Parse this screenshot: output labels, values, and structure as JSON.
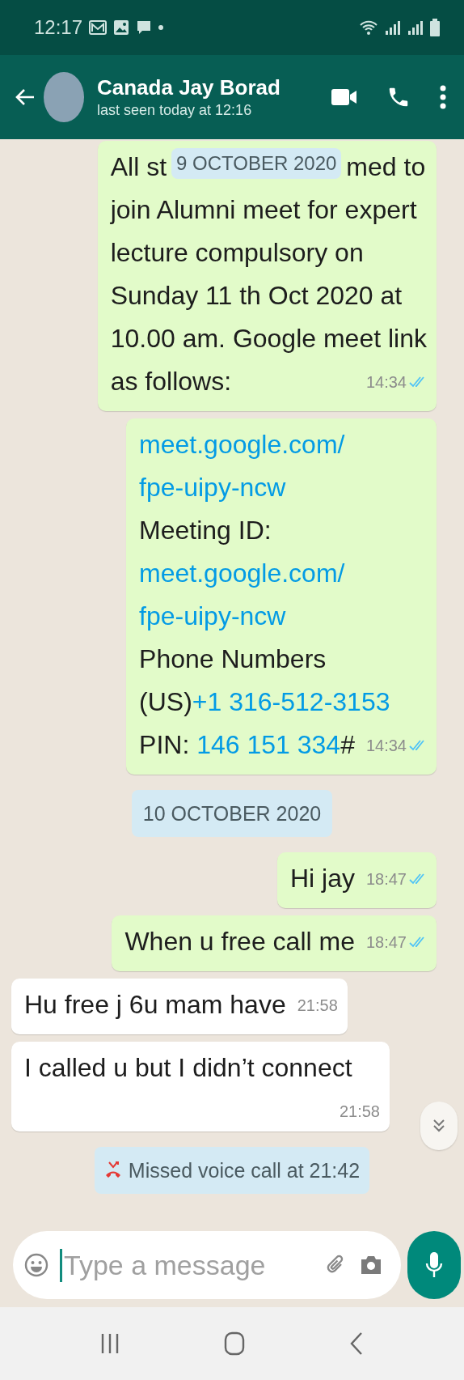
{
  "status_bar": {
    "time": "12:17"
  },
  "header": {
    "name": "Canada Jay Borad",
    "last_seen": "last seen today at 12:16"
  },
  "messages": [
    {
      "kind": "out",
      "covered_line": {
        "start": "All st",
        "date": "9 OCTOBER 2020",
        "end": "med to"
      },
      "lines": [
        [
          {
            "kind": "plain",
            "text": "join Alumni meet for expert"
          }
        ],
        [
          {
            "kind": "plain",
            "text": "lecture compulsory on"
          }
        ],
        [
          {
            "kind": "plain",
            "text": "Sunday 11 th Oct 2020 at"
          }
        ],
        [
          {
            "kind": "plain",
            "text": "10.00 am. Google meet link"
          }
        ],
        [
          {
            "kind": "plain",
            "text": "as follows:"
          }
        ]
      ],
      "time": "14:34",
      "read": true
    },
    {
      "kind": "out",
      "lines": [
        [
          {
            "kind": "link",
            "text": "meet.google.com/"
          }
        ],
        [
          {
            "kind": "link",
            "text": "fpe-uipy-ncw"
          }
        ],
        [
          {
            "kind": "plain",
            "text": "Meeting ID:"
          }
        ],
        [
          {
            "kind": "link",
            "text": "meet.google.com/"
          }
        ],
        [
          {
            "kind": "link",
            "text": "fpe-uipy-ncw"
          }
        ],
        [
          {
            "kind": "plain",
            "text": "Phone Numbers"
          }
        ],
        [
          {
            "kind": "plain",
            "text": "(US)"
          },
          {
            "kind": "link",
            "text": "+1 316-512-3153"
          }
        ],
        [
          {
            "kind": "plain",
            "text": "PIN: "
          },
          {
            "kind": "link",
            "text": "146 151 334"
          },
          {
            "kind": "plain",
            "text": "#"
          }
        ]
      ],
      "time": "14:34",
      "read": true
    },
    {
      "kind": "date",
      "text": "10 OCTOBER 2020"
    },
    {
      "kind": "out",
      "lines": [
        [
          {
            "kind": "plain",
            "text": "Hi jay"
          }
        ]
      ],
      "time": "18:47",
      "read": true
    },
    {
      "kind": "out",
      "lines": [
        [
          {
            "kind": "plain",
            "text": "When u free call me"
          }
        ]
      ],
      "time": "18:47",
      "read": true
    },
    {
      "kind": "in",
      "lines": [
        [
          {
            "kind": "plain",
            "text": "Hu free j 6u mam have"
          }
        ]
      ],
      "time": "21:58"
    },
    {
      "kind": "in",
      "lines": [
        [
          {
            "kind": "plain",
            "text": "I called u but I didn’t connect"
          }
        ]
      ],
      "time": "21:58"
    },
    {
      "kind": "call",
      "text": "Missed voice call at 21:42"
    }
  ],
  "composer": {
    "placeholder": "Type a message"
  }
}
